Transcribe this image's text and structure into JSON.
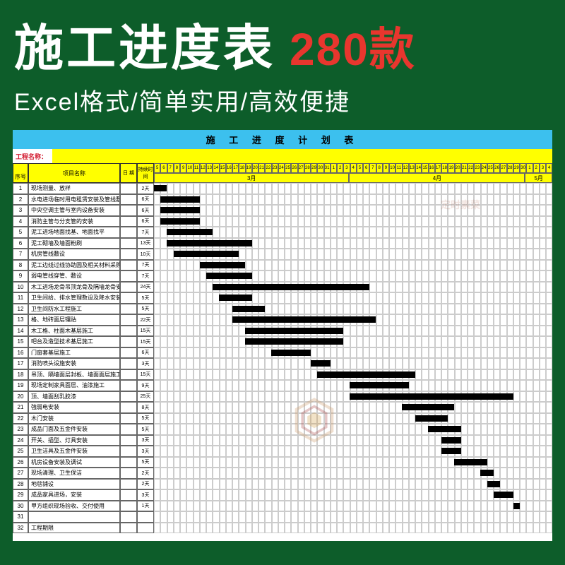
{
  "banner": {
    "title": "施工进度表",
    "count": "280款",
    "subtitle": "Excel格式/简单实用/高效便捷"
  },
  "chart": {
    "title": "施 工 进 度 计 划 表",
    "project_label": "工程名称：",
    "col_seq": "序号",
    "col_name": "项目名称",
    "col_date": "日 期",
    "col_dur": "持续时间",
    "months": [
      {
        "label": "3月",
        "span": 30
      },
      {
        "label": "4月",
        "span": 27
      },
      {
        "label": "5月",
        "span": 4
      }
    ],
    "days": [
      "5",
      "6",
      "7",
      "8",
      "9",
      "10",
      "11",
      "12",
      "13",
      "14",
      "15",
      "16",
      "17",
      "18",
      "19",
      "20",
      "21",
      "22",
      "23",
      "24",
      "25",
      "26",
      "27",
      "28",
      "29",
      "30",
      "31",
      "1",
      "2",
      "3",
      "4",
      "5",
      "6",
      "7",
      "8",
      "9",
      "10",
      "11",
      "12",
      "13",
      "14",
      "15",
      "16",
      "17",
      "18",
      "19",
      "20",
      "21",
      "22",
      "23",
      "24",
      "25",
      "26",
      "27",
      "28",
      "29",
      "30",
      "1",
      "2",
      "3",
      "4"
    ],
    "total_days": 61,
    "rows": [
      {
        "seq": "1",
        "name": "现场测量、放样",
        "dur": "2天",
        "start": 0,
        "len": 2
      },
      {
        "seq": "2",
        "name": "水电进场临时用电租赁安装及管线敷设套管",
        "dur": "6天",
        "start": 1,
        "len": 6
      },
      {
        "seq": "3",
        "name": "中央空调主管与室内设备安装",
        "dur": "6天",
        "start": 1,
        "len": 6
      },
      {
        "seq": "4",
        "name": "消防主管与分支管的安装",
        "dur": "6天",
        "start": 1,
        "len": 6
      },
      {
        "seq": "5",
        "name": "泥工进场地面找基、地面找平",
        "dur": "7天",
        "start": 2,
        "len": 7
      },
      {
        "seq": "6",
        "name": "泥工砌墙及墙面粉刷",
        "dur": "13天",
        "start": 2,
        "len": 13
      },
      {
        "seq": "7",
        "name": "机房管线敷设",
        "dur": "10天",
        "start": 3,
        "len": 10
      },
      {
        "seq": "8",
        "name": "泥工边线过线协助圆及相关材料采购",
        "dur": "7天",
        "start": 7,
        "len": 7
      },
      {
        "seq": "9",
        "name": "弱电管线穿管、敷设",
        "dur": "7天",
        "start": 8,
        "len": 7
      },
      {
        "seq": "10",
        "name": "木工进场龙骨吊顶龙骨及隔墙龙骨安装",
        "dur": "24天",
        "start": 9,
        "len": 24
      },
      {
        "seq": "11",
        "name": "卫生间给、排水管理数设及降水安装",
        "dur": "5天",
        "start": 10,
        "len": 5
      },
      {
        "seq": "12",
        "name": "卫生间防水工程施工",
        "dur": "5天",
        "start": 12,
        "len": 5
      },
      {
        "seq": "13",
        "name": "格、地砖面层镶贴",
        "dur": "22天",
        "start": 12,
        "len": 22
      },
      {
        "seq": "14",
        "name": "木工格、柱面木基层施工",
        "dur": "15天",
        "start": 14,
        "len": 15
      },
      {
        "seq": "15",
        "name": "吧台及造型技术基层施工",
        "dur": "15天",
        "start": 14,
        "len": 15
      },
      {
        "seq": "16",
        "name": "门窗套基层施工",
        "dur": "6天",
        "start": 18,
        "len": 6
      },
      {
        "seq": "17",
        "name": "消防喷头设施安装",
        "dur": "3天",
        "start": 24,
        "len": 3
      },
      {
        "seq": "18",
        "name": "吊顶、隔墙面层封板、墙面面层施工",
        "dur": "15天",
        "start": 25,
        "len": 15
      },
      {
        "seq": "19",
        "name": "现场定制家具面层、油漆施工",
        "dur": "9天",
        "start": 30,
        "len": 9
      },
      {
        "seq": "20",
        "name": "顶、墙面刮乳胶漆",
        "dur": "25天",
        "start": 30,
        "len": 25
      },
      {
        "seq": "21",
        "name": "強弱电安装",
        "dur": "8天",
        "start": 38,
        "len": 8
      },
      {
        "seq": "22",
        "name": "木门安装",
        "dur": "5天",
        "start": 40,
        "len": 5
      },
      {
        "seq": "23",
        "name": "成品门面及五金件安装",
        "dur": "5天",
        "start": 42,
        "len": 5
      },
      {
        "seq": "24",
        "name": "开关、插型、灯具安装",
        "dur": "3天",
        "start": 44,
        "len": 3
      },
      {
        "seq": "25",
        "name": "卫生洁具及五金件安装",
        "dur": "3天",
        "start": 44,
        "len": 3
      },
      {
        "seq": "26",
        "name": "机房设备安装及调试",
        "dur": "5天",
        "start": 46,
        "len": 5
      },
      {
        "seq": "27",
        "name": "现场清理、卫生保洁",
        "dur": "2天",
        "start": 50,
        "len": 2
      },
      {
        "seq": "28",
        "name": "地毯铺设",
        "dur": "2天",
        "start": 51,
        "len": 2
      },
      {
        "seq": "29",
        "name": "成品家具进场，安装",
        "dur": "3天",
        "start": 52,
        "len": 3
      },
      {
        "seq": "30",
        "name": "甲方组织现场验收、交付使用",
        "dur": "1天",
        "start": 55,
        "len": 1
      },
      {
        "seq": "31",
        "name": "",
        "dur": "",
        "start": null,
        "len": 0
      },
      {
        "seq": "32",
        "name": "工程期限",
        "dur": "",
        "start": null,
        "len": 0
      }
    ]
  }
}
